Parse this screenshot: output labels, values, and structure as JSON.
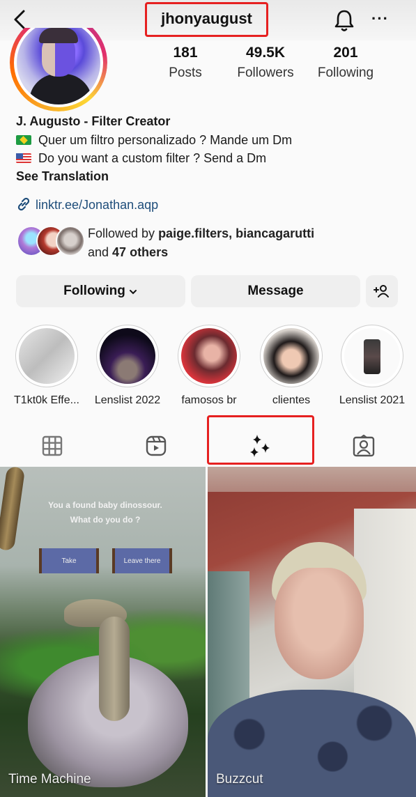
{
  "header": {
    "username": "jhonyaugust",
    "back_icon": "chevron-left-icon",
    "notifications_icon": "bell-icon",
    "more_icon": "more-horizontal-icon",
    "more_glyph": "···",
    "highlight_color": "#e62020"
  },
  "stats": [
    {
      "value": "181",
      "label": "Posts"
    },
    {
      "value": "49.5K",
      "label": "Followers"
    },
    {
      "value": "201",
      "label": "Following"
    }
  ],
  "bio": {
    "name": "J. Augusto - Filter Creator",
    "lines": [
      {
        "flag": "brazil-flag",
        "text": "Quer um filtro personalizado ? Mande um Dm"
      },
      {
        "flag": "usa-flag",
        "text": "Do you want a custom filter ? Send a Dm"
      }
    ],
    "see_translation": "See Translation",
    "link": "linktr.ee/Jonathan.aqp"
  },
  "followed_by": {
    "prefix": "Followed by ",
    "names": "paige.filters, biancagarutti",
    "and": "and ",
    "others": "47 others"
  },
  "actions": {
    "following": "Following",
    "following_chevron": "⌄",
    "message": "Message",
    "add_user_icon": "add-user-icon"
  },
  "highlights": [
    {
      "label": "T1kt0k Effe..."
    },
    {
      "label": "Lenslist 2022"
    },
    {
      "label": "famosos br"
    },
    {
      "label": "clientes"
    },
    {
      "label": "Lenslist 2021"
    }
  ],
  "tabs": [
    {
      "name": "posts",
      "icon": "grid-icon",
      "active": false
    },
    {
      "name": "reels",
      "icon": "reels-icon",
      "active": false
    },
    {
      "name": "effects",
      "icon": "sparkles-icon",
      "active": true
    },
    {
      "name": "tagged",
      "icon": "tagged-person-icon",
      "active": false
    }
  ],
  "effects": [
    {
      "title": "Time Machine",
      "overlay_text_1": "You a found baby dinossour.",
      "overlay_text_2": "What do you do ?",
      "option_1": "Take",
      "option_2": "Leave there"
    },
    {
      "title": "Buzzcut"
    }
  ]
}
